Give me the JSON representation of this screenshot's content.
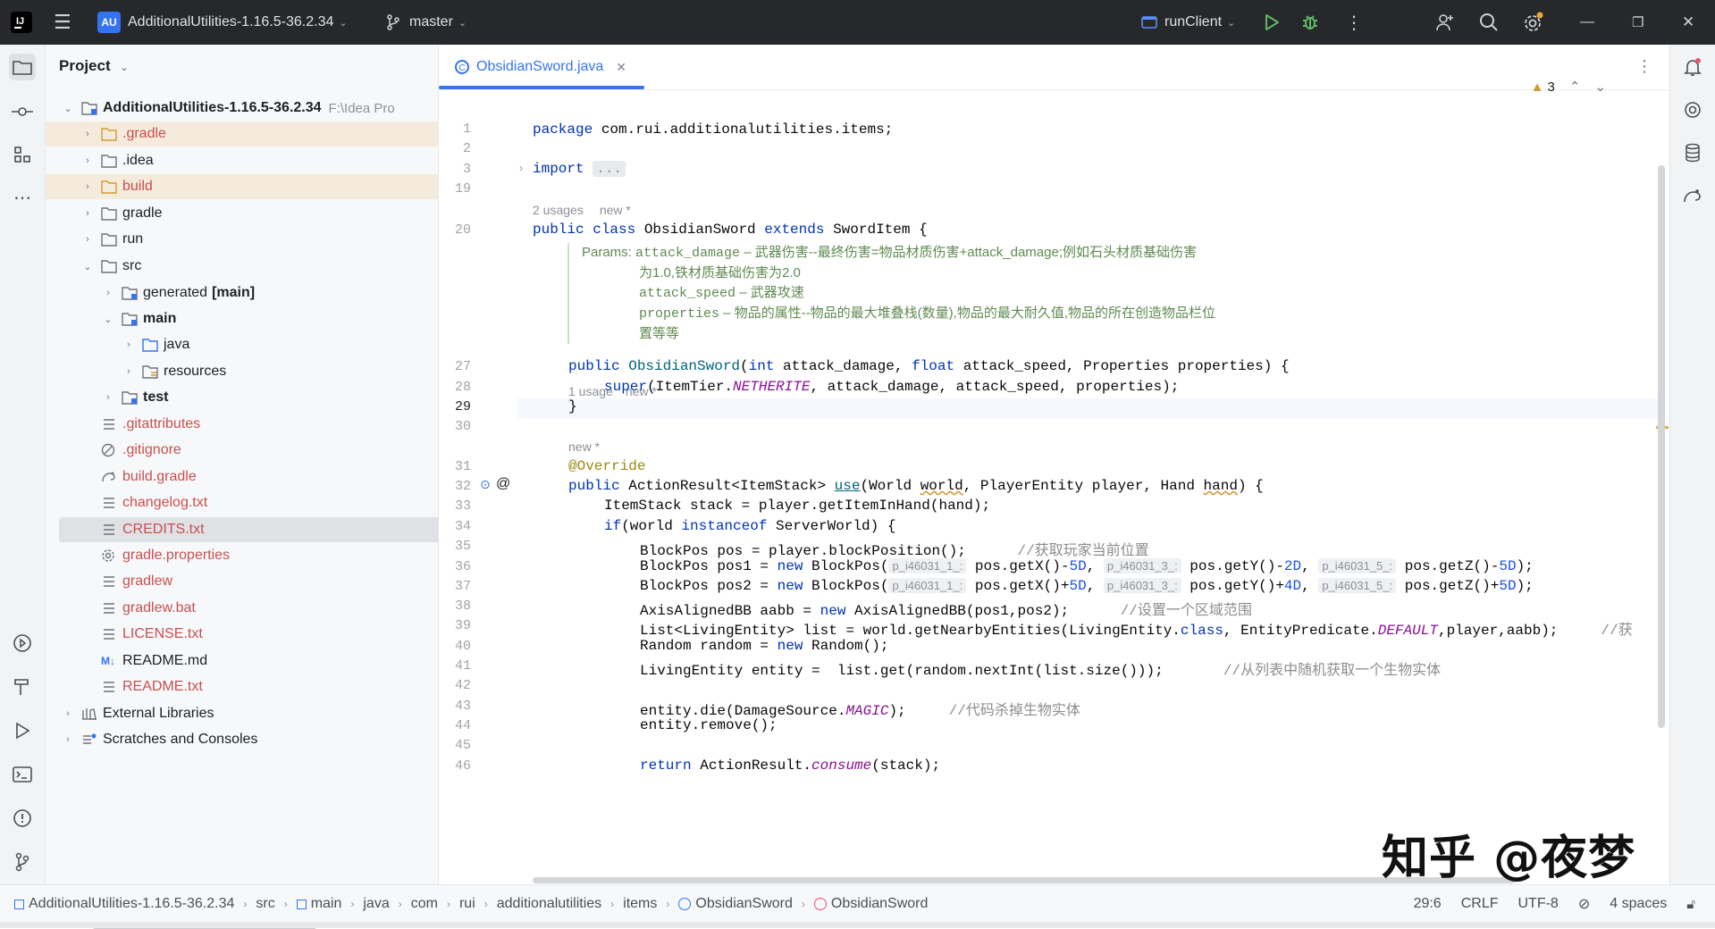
{
  "titlebar": {
    "project_badge": "AU",
    "project_name": "AdditionalUtilities-1.16.5-36.2.34",
    "branch": "master",
    "run_config": "runClient"
  },
  "project_panel": {
    "title": "Project",
    "root": {
      "label": "AdditionalUtilities-1.16.5-36.2.34",
      "path_hint": "F:\\Idea Pro"
    },
    "items": [
      {
        "label": ".gradle"
      },
      {
        "label": ".idea"
      },
      {
        "label": "build"
      },
      {
        "label": "gradle"
      },
      {
        "label": "run"
      },
      {
        "label": "src"
      },
      {
        "label": "generated",
        "suffix": "[main]"
      },
      {
        "label": "main"
      },
      {
        "label": "java"
      },
      {
        "label": "resources"
      },
      {
        "label": "test"
      },
      {
        "label": ".gitattributes"
      },
      {
        "label": ".gitignore"
      },
      {
        "label": "build.gradle"
      },
      {
        "label": "changelog.txt"
      },
      {
        "label": "CREDITS.txt"
      },
      {
        "label": "gradle.properties"
      },
      {
        "label": "gradlew"
      },
      {
        "label": "gradlew.bat"
      },
      {
        "label": "LICENSE.txt"
      },
      {
        "label": "README.md"
      },
      {
        "label": "README.txt"
      },
      {
        "label": "External Libraries"
      },
      {
        "label": "Scratches and Consoles"
      }
    ]
  },
  "editor": {
    "tab": "ObsidianSword.java",
    "warnings": "3",
    "line_numbers": [
      "1",
      "2",
      "3",
      "19",
      "20",
      "27",
      "28",
      "29",
      "30",
      "31",
      "32",
      "33",
      "34",
      "35",
      "36",
      "37",
      "38",
      "39",
      "40",
      "41",
      "42",
      "43",
      "44",
      "45",
      "46"
    ],
    "hints": {
      "usages_class": "2 usages",
      "new_class": "new *",
      "usages_ctor": "1 usage",
      "new_ctor": "new *",
      "new_override": "new *"
    },
    "doc": {
      "params_label": "Params:",
      "p1_name": "attack_damage",
      "p1_text": " – 武器伤害--最终伤害=物品材质伤害+attack_damage;例如石头材质基础伤害",
      "p1_text2": "为1.0,铁材质基础伤害为2.0",
      "p2_name": "attack_speed",
      "p2_text": " – 武器攻速",
      "p3_name": "properties",
      "p3_text": " – 物品的属性--物品的最大堆叠栈(数量),物品的最大耐久值,物品的所在创造物品栏位",
      "p3_text2": "置等等"
    },
    "code": {
      "l1_kw": "package",
      "l1_rest": " com.rui.additionalutilities.items;",
      "l3_kw": "import",
      "l3_fold": "...",
      "l20_a": "public class",
      "l20_b": " ObsidianSword ",
      "l20_c": "extends",
      "l20_d": " SwordItem {",
      "l27_kw": "public",
      "l27_fn": " ObsidianSword",
      "l27_a": "(",
      "l27_t1": "int",
      "l27_b": " attack_damage, ",
      "l27_t2": "float",
      "l27_c": " attack_speed, Properties properties) {",
      "l28_kw": "super",
      "l28_a": "(ItemTier.",
      "l28_it": "NETHERITE",
      "l28_b": ", attack_damage, attack_speed, properties);",
      "l29": "}",
      "l31": "@Override",
      "l32_kw": "public",
      "l32_a": " ActionResult<ItemStack> ",
      "l32_fn": "use",
      "l32_b": "(World ",
      "l32_w": "world",
      "l32_c": ", PlayerEntity player, Hand ",
      "l32_h": "hand",
      "l32_d": ") {",
      "l33": "ItemStack stack = player.getItemInHand(hand);",
      "l34_kw": "if",
      "l34_a": "(world ",
      "l34_kw2": "instanceof",
      "l34_b": " ServerWorld) {",
      "l35_a": "BlockPos pos = player.blockPosition();",
      "l35_cm": "//获取玩家当前位置",
      "l36_a": "BlockPos pos1 = ",
      "l36_kw": "new",
      "l36_b": " BlockPos(",
      "ph1": "p_i46031_1_:",
      "l36_c": " pos.getX()-",
      "l36_n1": "5D",
      "ph2": "p_i46031_3_:",
      "l36_d": " pos.getY()-",
      "l36_n2": "2D",
      "ph3": "p_i46031_5_:",
      "l36_e": " pos.getZ()-",
      "l36_n3": "5D",
      "l36_f": ");",
      "l37_a": "BlockPos pos2 = ",
      "l37_c": " pos.getX()+",
      "l37_n1": "5D",
      "l37_d": " pos.getY()+",
      "l37_n2": "4D",
      "l37_e": " pos.getZ()+",
      "l37_n3": "5D",
      "l38_a": "AxisAlignedBB aabb = ",
      "l38_kw": "new",
      "l38_b": " AxisAlignedBB(pos1,pos2);",
      "l38_cm": "//设置一个区域范围",
      "l39_a": "List<LivingEntity> list = world.getNearbyEntities(LivingEntity.",
      "l39_kw": "class",
      "l39_b": ", EntityPredicate.",
      "l39_it": "DEFAULT",
      "l39_c": ",player,aabb);",
      "l39_cm": "//获",
      "l40_a": "Random random = ",
      "l40_kw": "new",
      "l40_b": " Random();",
      "l41_a": "LivingEntity entity =  list.get(random.nextInt(list.size()));",
      "l41_cm": "//从列表中随机获取一个生物实体",
      "l43_a": "entity.die(DamageSource.",
      "l43_it": "MAGIC",
      "l43_b": ");",
      "l43_cm": "//代码杀掉生物实体",
      "l44": "entity.remove();",
      "l46_kw": "return",
      "l46_a": " ActionResult.",
      "l46_it": "consume",
      "l46_b": "(stack);"
    },
    "watermark": "知乎 @夜梦"
  },
  "statusbar": {
    "breadcrumbs": [
      "AdditionalUtilities-1.16.5-36.2.34",
      "src",
      "main",
      "java",
      "com",
      "rui",
      "additionalutilities",
      "items",
      "ObsidianSword",
      "ObsidianSword"
    ],
    "position": "29:6",
    "line_sep": "CRLF",
    "encoding": "UTF-8",
    "indent": "4 spaces"
  },
  "colors": {
    "accent": "#3574f0",
    "titlebar_bg": "#27282c",
    "excluded_folder": "#c94f4f",
    "keyword": "#0033b3",
    "comment": "#8c8c8c"
  }
}
